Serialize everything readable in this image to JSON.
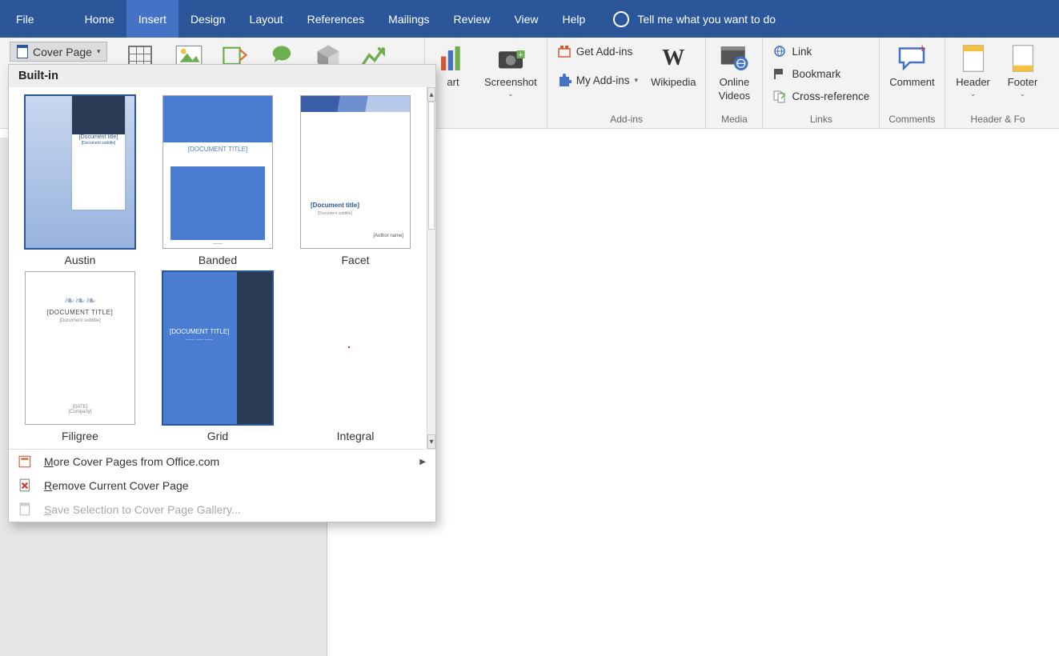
{
  "tabs": {
    "file": "File",
    "home": "Home",
    "insert": "Insert",
    "design": "Design",
    "layout": "Layout",
    "references": "References",
    "mailings": "Mailings",
    "review": "Review",
    "view": "View",
    "help": "Help"
  },
  "tell_me": "Tell me what you want to do",
  "cover_page": {
    "label": "Cover Page"
  },
  "ribbon": {
    "chart_suffix": "art",
    "screenshot": "Screenshot",
    "get_addins": "Get Add-ins",
    "my_addins": "My Add-ins",
    "wikipedia": "Wikipedia",
    "online_videos_l1": "Online",
    "online_videos_l2": "Videos",
    "link": "Link",
    "bookmark": "Bookmark",
    "cross_ref": "Cross-reference",
    "comment": "Comment",
    "header": "Header",
    "footer": "Footer",
    "group_addins": "Add-ins",
    "group_media": "Media",
    "group_links": "Links",
    "group_comments": "Comments",
    "group_headerfooter": "Header & Fo"
  },
  "dropdown": {
    "section": "Built-in",
    "items": [
      {
        "name": "Austin"
      },
      {
        "name": "Banded"
      },
      {
        "name": "Facet"
      },
      {
        "name": "Filigree"
      },
      {
        "name": "Grid"
      },
      {
        "name": "Integral"
      }
    ],
    "doc_title_caps": "[DOCUMENT TITLE]",
    "doc_title": "[Document title]",
    "doc_subtitle": "[Document subtitle]",
    "more": "More Cover Pages from Office.com",
    "remove": "Remove Current Cover Page",
    "save": "Save Selection to Cover Page Gallery..."
  }
}
